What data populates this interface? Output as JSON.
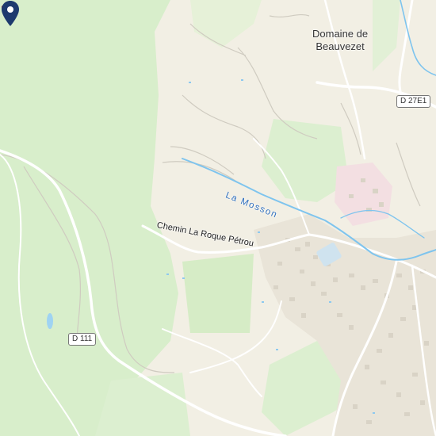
{
  "map": {
    "colors": {
      "background": "#f2efe4",
      "forest": "#d8eecb",
      "forest_dark": "#cde8c0",
      "road": "#ffffff",
      "water": "#7ec4ee",
      "buildings": "#d9d3c6",
      "hospital_area": "#f3dfe2",
      "pin": "#1d3a6e"
    },
    "places": {
      "domaine_line1": "Domaine de",
      "domaine_line2": "Beauvezet"
    },
    "roads": {
      "chemin": "Chemin La Roque Pétrou",
      "d111": "D 111",
      "d27e1": "D 27E1"
    },
    "water": {
      "river": "La Mosson"
    },
    "icons": {
      "marker": "location-pin",
      "poi": "hospital-cross"
    }
  }
}
